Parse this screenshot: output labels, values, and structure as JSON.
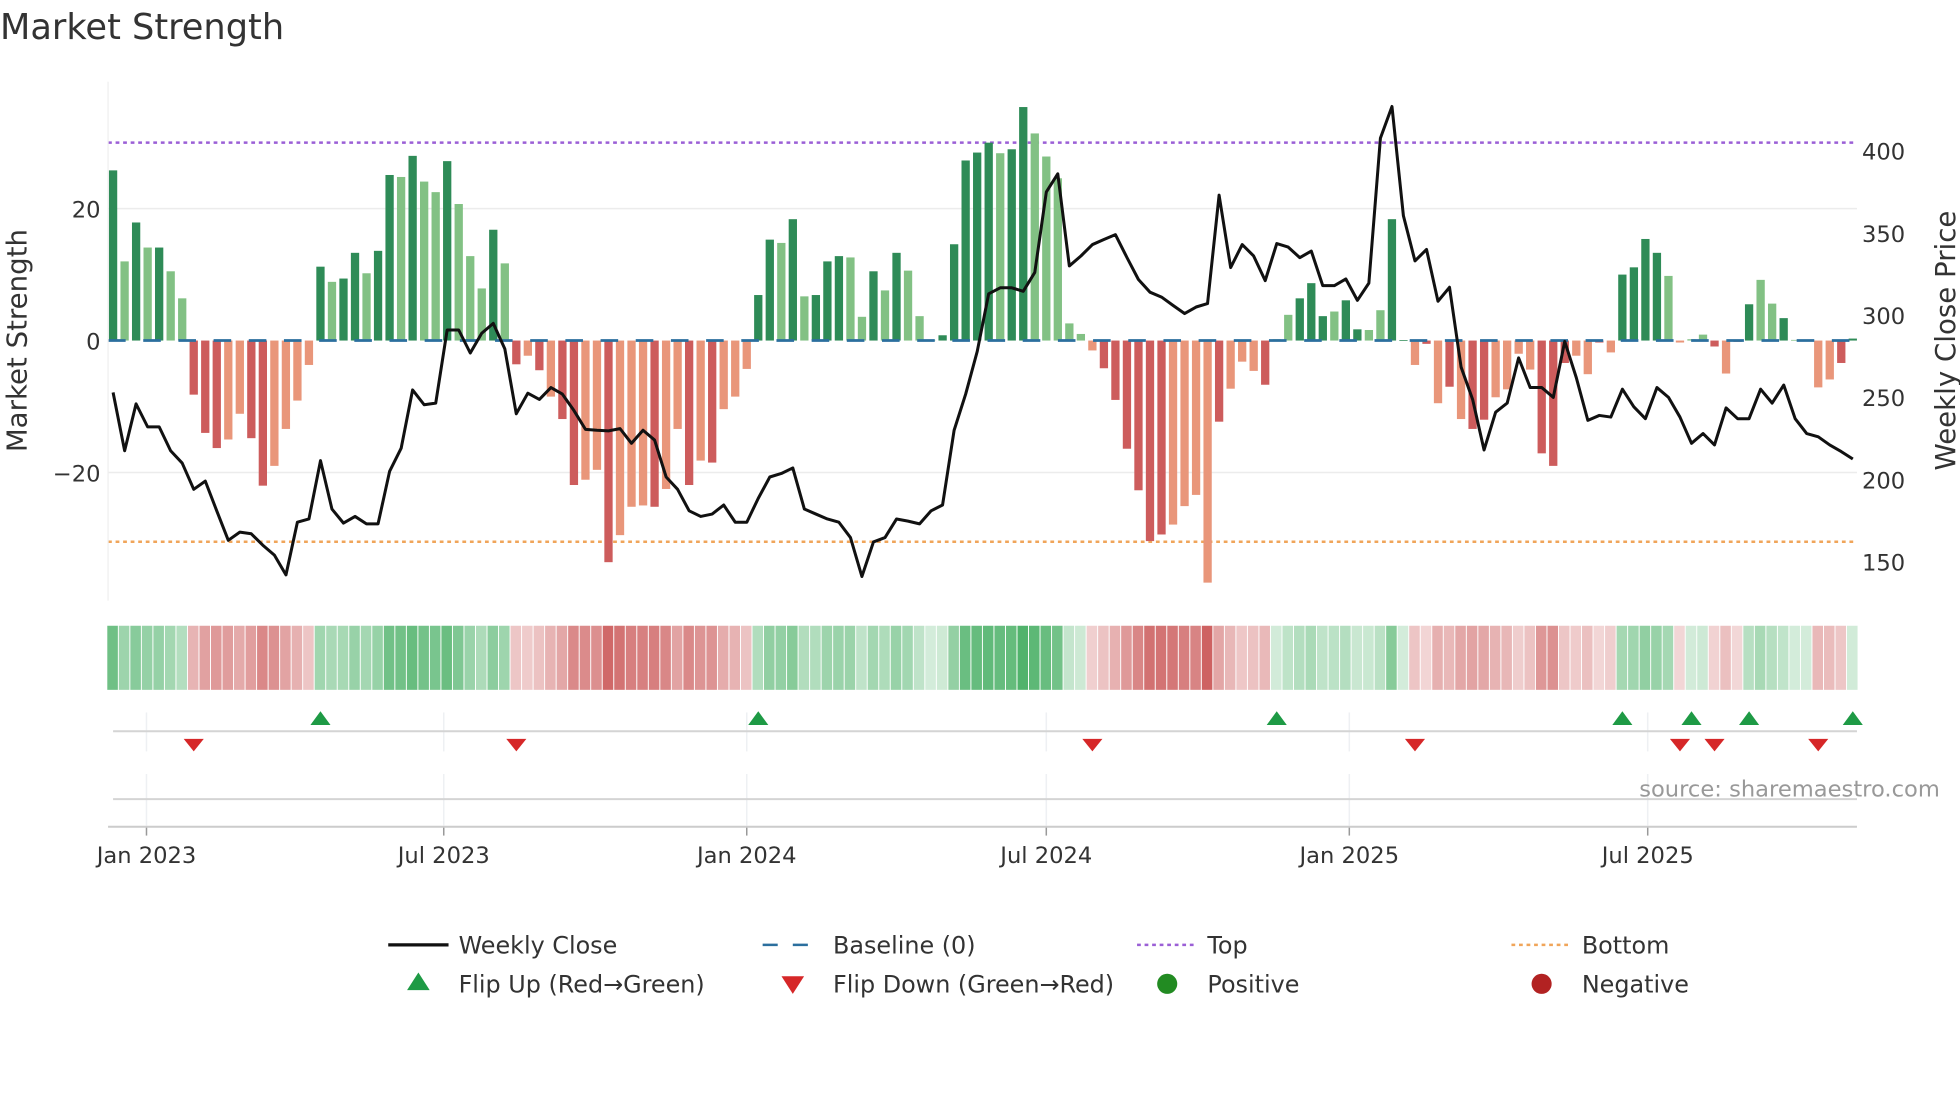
{
  "chart_data": {
    "type": "bar",
    "title": "Market Strength",
    "ylabel": "Market Strength",
    "y2label": "Weekly Close Price",
    "ylim": [
      -39,
      39
    ],
    "y2lim": [
      128,
      448
    ],
    "yticks": [
      -20,
      0,
      20
    ],
    "yticklabels": [
      "−20",
      "0",
      "20"
    ],
    "y2ticks": [
      150,
      200,
      250,
      300,
      350,
      400
    ],
    "y2ticklabels": [
      "150",
      "200",
      "250",
      "300",
      "350",
      "400"
    ],
    "xticks": [
      {
        "week": 2.9,
        "label": "Jan 2023"
      },
      {
        "week": 28.7,
        "label": "Jul 2023"
      },
      {
        "week": 55.0,
        "label": "Jan 2024"
      },
      {
        "week": 81.0,
        "label": "Jul 2024"
      },
      {
        "week": 107.3,
        "label": "Jan 2025"
      },
      {
        "week": 133.2,
        "label": "Jul 2025"
      }
    ],
    "thresholds": {
      "top": 30,
      "bottom": -30.5,
      "baseline": 0
    },
    "strength": [
      25.8,
      12,
      17.9,
      14.1,
      14.1,
      10.5,
      6.4,
      -8.2,
      -14,
      -16.3,
      -15,
      -11.1,
      -14.8,
      -22,
      -19,
      -13.4,
      -9.1,
      -3.7,
      11.2,
      8.9,
      9.4,
      13.3,
      10.2,
      13.6,
      25.1,
      24.8,
      28,
      24.1,
      22.5,
      27.2,
      20.7,
      12.8,
      7.9,
      16.8,
      11.7,
      -3.6,
      -2.3,
      -4.5,
      -8.5,
      -11.9,
      -21.9,
      -21.1,
      -19.6,
      -33.6,
      -29.5,
      -25.2,
      -25,
      -25.2,
      -22.5,
      -13.4,
      -21.9,
      -18.2,
      -18.5,
      -10.4,
      -8.5,
      -4.3,
      6.9,
      15.3,
      14.8,
      18.4,
      6.7,
      6.9,
      12,
      12.8,
      12.6,
      3.6,
      10.5,
      7.6,
      13.3,
      10.6,
      3.7,
      0.1,
      0.8,
      14.6,
      27.3,
      28.5,
      30,
      28.4,
      29,
      35.4,
      31.4,
      27.9,
      24.6,
      2.6,
      1.0,
      -1.5,
      -4.2,
      -9,
      -16.4,
      -22.7,
      -30.4,
      -29.4,
      -27.9,
      -25.1,
      -23.4,
      -36.7,
      -12.3,
      -7.3,
      -3.2,
      -4.6,
      -6.7,
      0.2,
      3.9,
      6.4,
      8.7,
      3.7,
      4.4,
      6.1,
      1.7,
      1.6,
      4.6,
      18.4,
      0.05,
      -3.7,
      -0.5,
      -9.5,
      -7,
      -11.9,
      -13.4,
      -12,
      -8.6,
      -7.4,
      -2,
      -4.4,
      -17.1,
      -19,
      -3.4,
      -2.3,
      -5.1,
      -0.3,
      -1.8,
      10,
      11.1,
      15.4,
      13.3,
      9.8,
      -0.3,
      0.2,
      0.9,
      -0.9,
      -5,
      -0.2,
      5.5,
      9.2,
      5.6,
      3.4,
      0.1,
      0.1,
      -7.1,
      -5.9,
      -3.4,
      0.3
    ],
    "shade": "dldldlldddllddlllldlddlddldlldllldldldlddlldllldlldldlllddldldddlldldllldddddlddllllllddddddlllldllldlldddlddlldd ldldlddlllldddlldlddddlllldlddlldllllddlld",
    "weekly_close": [
      253,
      217.5,
      246,
      232,
      232,
      217.5,
      210,
      194,
      199,
      181,
      163,
      168,
      167,
      160,
      154,
      142,
      174,
      176,
      211.5,
      182,
      173.5,
      177.5,
      173,
      173,
      205,
      219,
      254.5,
      245.5,
      246.5,
      291,
      291,
      277,
      289,
      295,
      279.5,
      240,
      252.5,
      248.7,
      256,
      252,
      242,
      230.5,
      230,
      229.6,
      231,
      222,
      230,
      224,
      201.5,
      194,
      181,
      177.5,
      179,
      184.5,
      174,
      174,
      188.5,
      201.5,
      203.7,
      207,
      182,
      179,
      176,
      174,
      164.7,
      141,
      162,
      164.7,
      176,
      174.7,
      173,
      181,
      184.5,
      230,
      252,
      278,
      313,
      316.7,
      316.7,
      314.5,
      326,
      375,
      386,
      330,
      336,
      343,
      346,
      349,
      335,
      321.7,
      314,
      311,
      306,
      301,
      305,
      307,
      373,
      329,
      343,
      336,
      321,
      343.6,
      341.4,
      335,
      339,
      318,
      318,
      322,
      309,
      319.5,
      407.7,
      427,
      360.5,
      333,
      340,
      308.5,
      317,
      268.4,
      248.7,
      218,
      241,
      246.5,
      274,
      256,
      256,
      250,
      284,
      262,
      236,
      239,
      238,
      255,
      244.3,
      237,
      256,
      250,
      238,
      222,
      228,
      221,
      243.6,
      237,
      237,
      255,
      246.5,
      257.5,
      237,
      228,
      226,
      221,
      217,
      212.5
    ],
    "colors": {
      "pos_strong": "#2e8b57",
      "pos_weak": "#82c184",
      "neg_strong": "#cd5c5c",
      "neg_weak": "#e9967a",
      "line": "#111111",
      "baseline": "#2b6f9e",
      "top": "#9b5fd6",
      "bottom": "#f0a55a",
      "flip_up": "#1e9a45",
      "flip_down": "#d62728",
      "positive": "#228b22",
      "negative": "#b22222"
    },
    "legend": [
      {
        "key": "line",
        "label": "Weekly Close"
      },
      {
        "key": "baseline",
        "label": "Baseline (0)"
      },
      {
        "key": "top",
        "label": "Top"
      },
      {
        "key": "bottom",
        "label": "Bottom"
      },
      {
        "key": "flip_up",
        "label": "Flip Up (Red→Green)"
      },
      {
        "key": "flip_down",
        "label": "Flip Down (Green→Red)"
      },
      {
        "key": "positive",
        "label": "Positive"
      },
      {
        "key": "negative",
        "label": "Negative"
      }
    ],
    "legend_position": "bottom",
    "source": "source: sharemaestro.com"
  }
}
